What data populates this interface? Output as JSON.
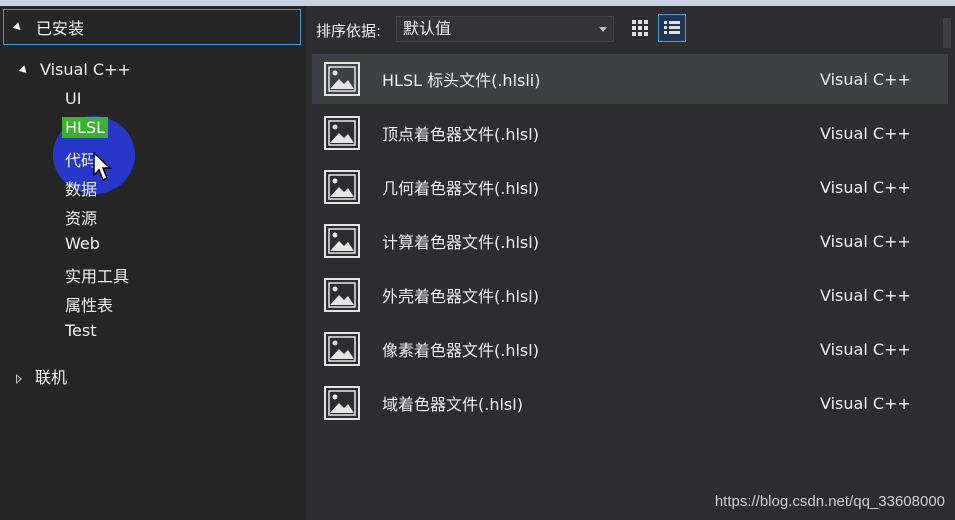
{
  "left_panel": {
    "installed_label": "已安装",
    "tree": {
      "visual_cpp": {
        "label": "Visual C++",
        "children": [
          "UI",
          "HLSL",
          "代码",
          "数据",
          "资源",
          "Web",
          "实用工具",
          "属性表",
          "Test"
        ]
      },
      "online": "联机"
    },
    "selected": "HLSL"
  },
  "right_panel": {
    "sort_label": "排序依据:",
    "sort_value": "默认值",
    "templates": [
      {
        "name": "HLSL 标头文件(.hlsli)",
        "type": "Visual C++"
      },
      {
        "name": "顶点着色器文件(.hlsl)",
        "type": "Visual C++"
      },
      {
        "name": "几何着色器文件(.hlsl)",
        "type": "Visual C++"
      },
      {
        "name": "计算着色器文件(.hlsl)",
        "type": "Visual C++"
      },
      {
        "name": "外壳着色器文件(.hlsl)",
        "type": "Visual C++"
      },
      {
        "name": "像素着色器文件(.hlsl)",
        "type": "Visual C++"
      },
      {
        "name": "域着色器文件(.hlsl)",
        "type": "Visual C++"
      }
    ]
  },
  "watermark": "https://blog.csdn.net/qq_33608000",
  "colors": {
    "accent": "#3f9bdc",
    "selected_green": "#3ab22e",
    "cursor_circle": "#283ce6"
  }
}
